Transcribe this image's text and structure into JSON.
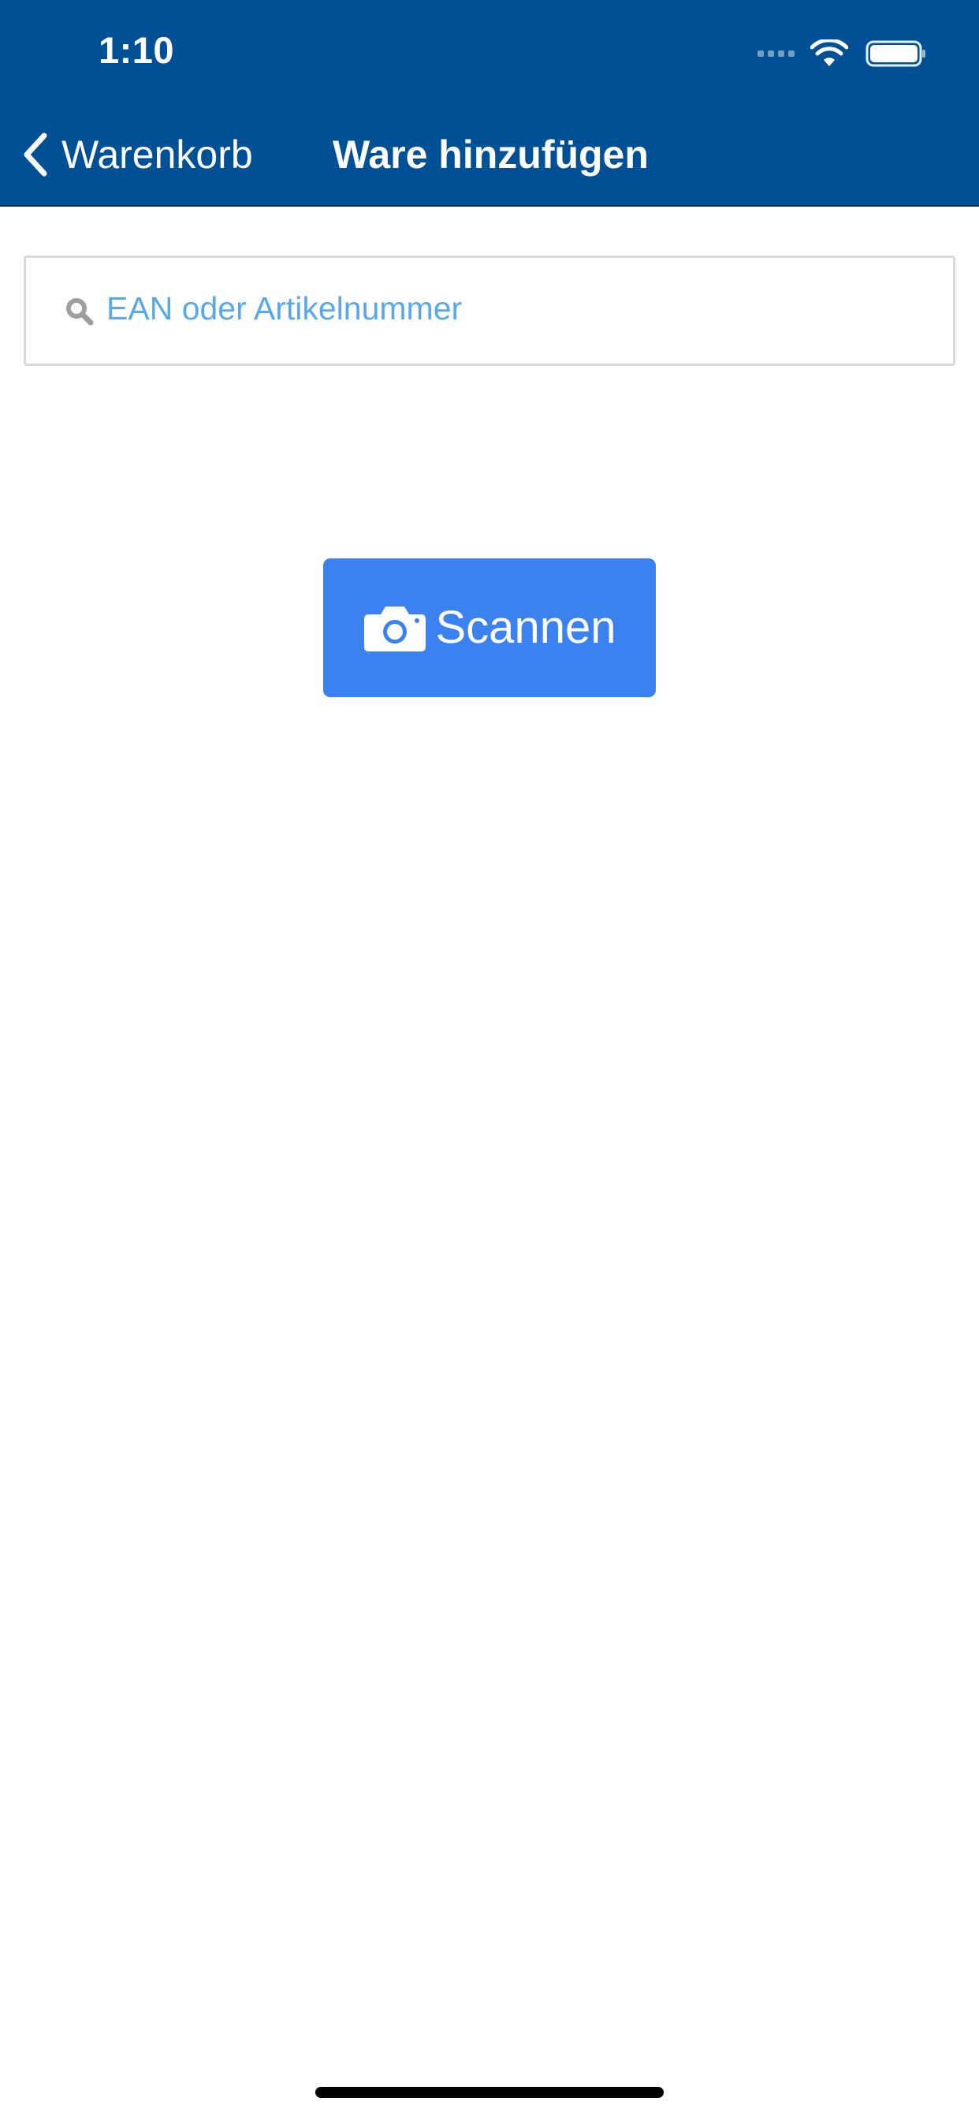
{
  "status_bar": {
    "time": "1:10",
    "icons": [
      "signal-icon",
      "wifi-icon",
      "battery-icon"
    ]
  },
  "nav": {
    "back_label": "Warenkorb",
    "title": "Ware hinzufügen"
  },
  "search": {
    "placeholder": "EAN oder Artikelnummer",
    "value": ""
  },
  "scan_button": {
    "label": "Scannen",
    "icon": "camera-icon"
  },
  "colors": {
    "header_bg": "#005096",
    "button_bg": "#3b82f0",
    "placeholder": "#5aa9e6"
  }
}
